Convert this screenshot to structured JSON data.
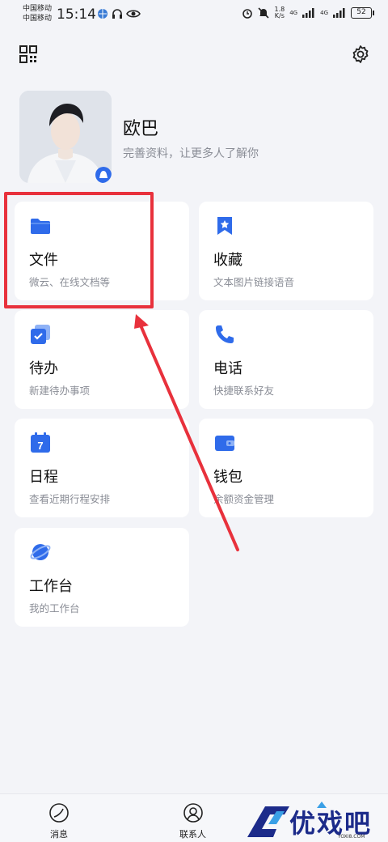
{
  "status_bar": {
    "carrier_1": "中国移动",
    "carrier_2": "中国移动",
    "time": "15:14",
    "speed_value": "1.8",
    "speed_unit": "K/s",
    "net_1": "4G",
    "net_2": "4G",
    "battery": "52"
  },
  "profile": {
    "nickname": "欧巴",
    "subtitle": "完善资料，让更多人了解你"
  },
  "cards": [
    {
      "title": "文件",
      "subtitle": "微云、在线文档等",
      "icon": "folder-icon",
      "color": "#2f6bea"
    },
    {
      "title": "收藏",
      "subtitle": "文本图片链接语音",
      "icon": "bookmark-star-icon",
      "color": "#2f6bea"
    },
    {
      "title": "待办",
      "subtitle": "新建待办事项",
      "icon": "todo-check-icon",
      "color": "#2f6bea"
    },
    {
      "title": "电话",
      "subtitle": "快捷联系好友",
      "icon": "phone-icon",
      "color": "#2f6bea"
    },
    {
      "title": "日程",
      "subtitle": "查看近期行程安排",
      "icon": "calendar-icon",
      "calendar_day": "7",
      "color": "#2f6bea"
    },
    {
      "title": "钱包",
      "subtitle": "余额资金管理",
      "icon": "wallet-icon",
      "color": "#2f6bea"
    },
    {
      "title": "工作台",
      "subtitle": "我的工作台",
      "icon": "planet-icon",
      "color": "#2f6bea"
    }
  ],
  "tabbar": {
    "messages_label": "消息",
    "contacts_label": "联系人"
  },
  "watermark": {
    "text": "优戏吧",
    "url": "YOXI8.COM"
  },
  "colors": {
    "accent": "#2f6bea",
    "highlight": "#e8313c",
    "background": "#f3f4f8"
  }
}
